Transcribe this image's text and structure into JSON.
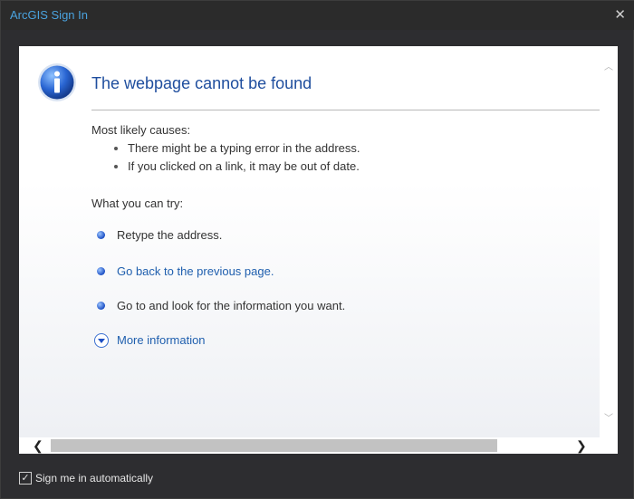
{
  "window": {
    "title": "ArcGIS Sign In"
  },
  "page": {
    "heading": "The webpage cannot be found",
    "causes_label": "Most likely causes:",
    "causes": [
      "There might be a typing error in the address.",
      "If you clicked on a link, it may be out of date."
    ],
    "try_label": "What you can try:",
    "retype": "Retype the address.",
    "go_back": "Go back to the previous page.",
    "go_to": "Go to  and look for the information you want.",
    "more_info": "More information"
  },
  "footer": {
    "auto_signin_label": "Sign me in automatically",
    "auto_signin_checked": true
  },
  "icons": [
    "info-icon",
    "close-icon",
    "scroll-up-icon",
    "scroll-down-icon",
    "scroll-left-icon",
    "scroll-right-icon",
    "expand-icon"
  ],
  "colors": {
    "title": "#4aa3df",
    "heading": "#1f4e9e",
    "link": "#1f5fae"
  }
}
